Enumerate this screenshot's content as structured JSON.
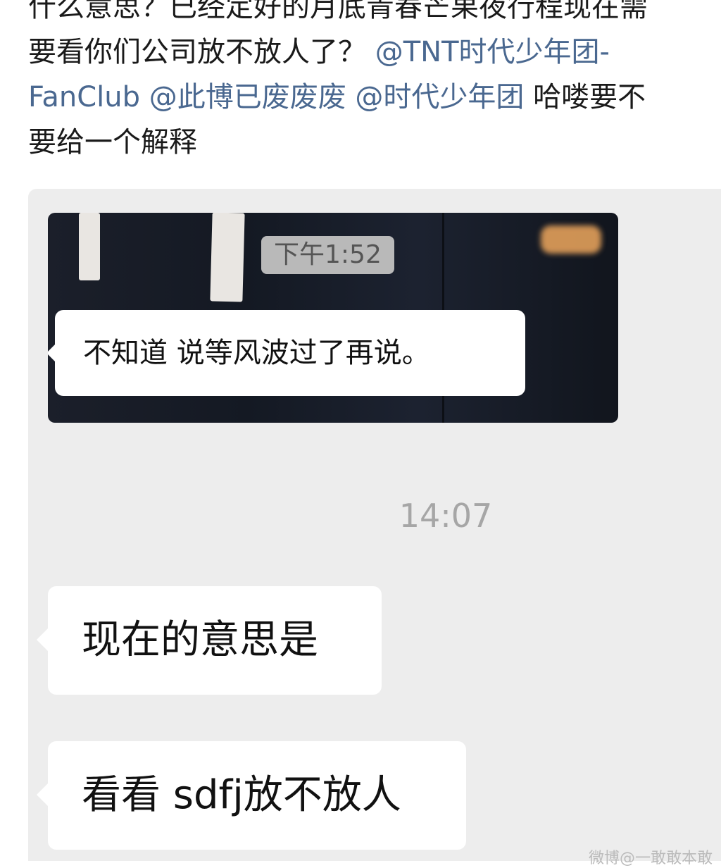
{
  "post": {
    "line1": "什么意思？已经定好的月底青春芒果夜行程现在需",
    "line2_text": "要看你们公司放不放人了？",
    "line2_mention": "@TNT时代少年团-",
    "line3_mention1": "FanClub @此博已废废废",
    "line3_mention2": "@时代少年团",
    "line3_text": "哈喽要不",
    "line4": "要给一个解释"
  },
  "chat": {
    "photo_time": "下午1:52",
    "photo_message": "不知道 说等风波过了再说。",
    "timestamp": "14:07",
    "messages": [
      "现在的意思是",
      "看看 sdfj放不放人"
    ]
  },
  "watermark": "微博@一敢敢本敢"
}
